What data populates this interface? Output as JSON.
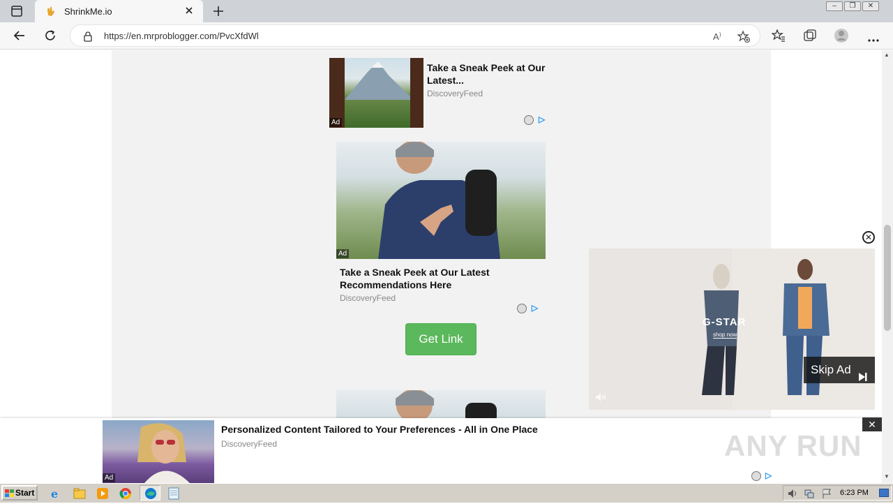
{
  "browser": {
    "tab_title": "ShrinkMe.io",
    "url": "https://en.mrproblogger.com/PvcXfdWl"
  },
  "ads": {
    "top": {
      "badge": "Ad",
      "title": "Take a Sneak Peek at Our Latest...",
      "source": "DiscoveryFeed"
    },
    "middle": {
      "badge": "Ad",
      "title": "Take a Sneak Peek at Our Latest Recommendations Here",
      "source": "DiscoveryFeed"
    },
    "bottom_banner": {
      "badge": "Ad",
      "title": "Personalized Content Tailored to Your Preferences - All in One Place",
      "source": "DiscoveryFeed"
    },
    "video": {
      "brand": "G-STAR",
      "shop_now": "shop now",
      "skip_label": "Skip Ad"
    }
  },
  "main": {
    "get_link_label": "Get Link"
  },
  "taskbar": {
    "start_label": "Start",
    "time": "6:23 PM"
  },
  "watermark": "ANY RUN",
  "colors": {
    "accent_green": "#5cb85c",
    "adchoices_blue": "#2196f3",
    "page_bg": "#f2f2f2"
  }
}
